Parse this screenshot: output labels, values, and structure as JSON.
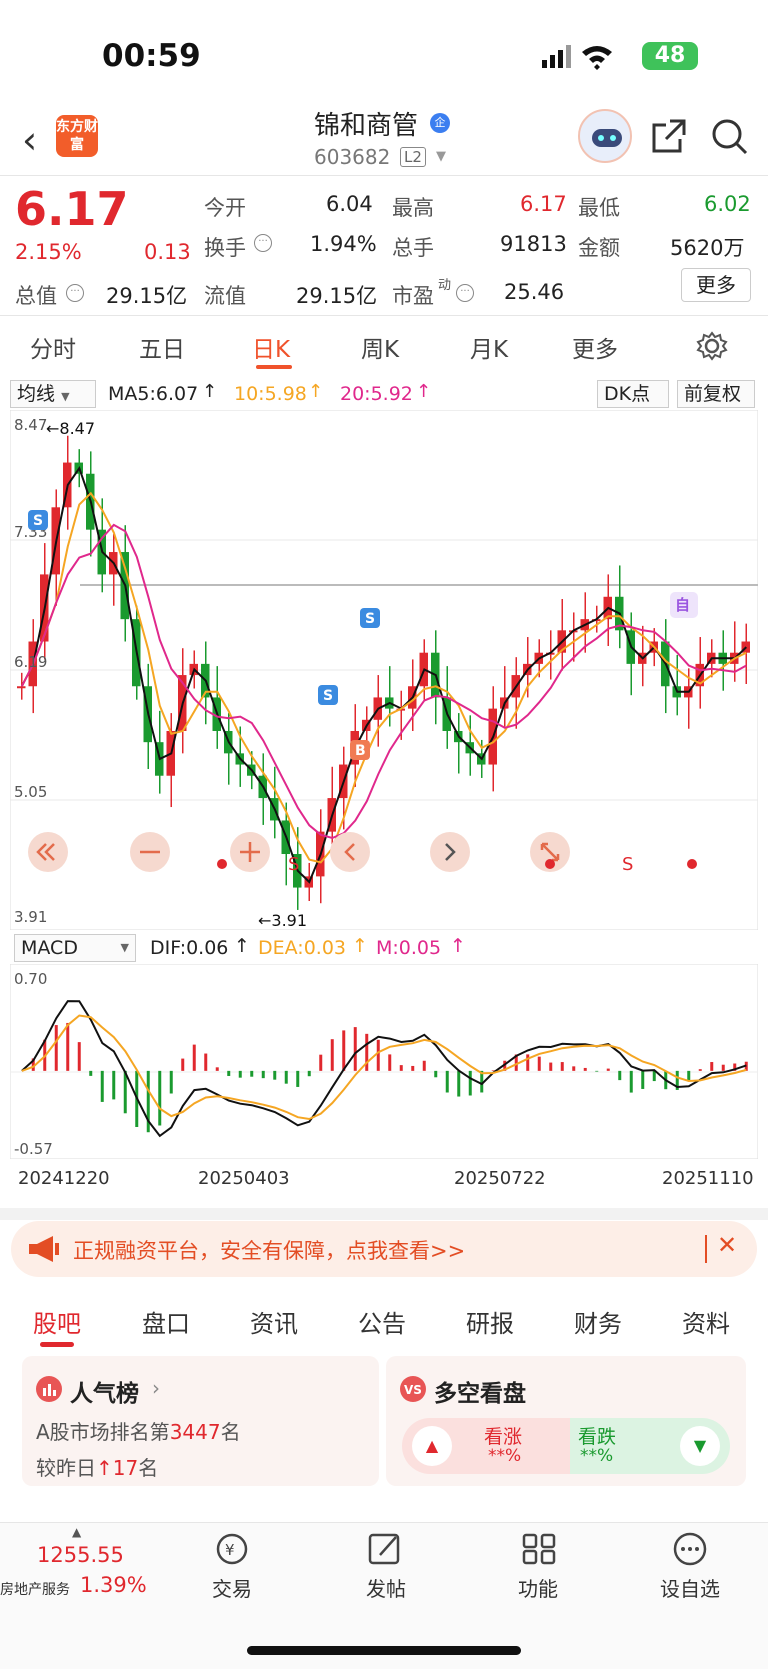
{
  "status_bar": {
    "time": "00:59",
    "battery": "48"
  },
  "header": {
    "logo_text": "东方财富",
    "stock_name": "锦和商管",
    "badge": "企",
    "stock_code": "603682",
    "level": "L2"
  },
  "quote": {
    "price": "6.17",
    "change_pct": "2.15%",
    "change": "0.13",
    "open_label": "今开",
    "open": "6.04",
    "high_label": "最高",
    "high": "6.17",
    "low_label": "最低",
    "low": "6.02",
    "turnover_label": "换手",
    "turnover": "1.94%",
    "volume_label": "总手",
    "volume": "91813",
    "amount_label": "金额",
    "amount": "5620万",
    "mktcap_label": "总值",
    "mktcap": "29.15亿",
    "float_label": "流值",
    "float": "29.15亿",
    "pe_label": "市盈",
    "pe_sup": "动",
    "pe": "25.46",
    "more_label": "更多"
  },
  "period_tabs": [
    "分时",
    "五日",
    "日K",
    "周K",
    "月K",
    "更多"
  ],
  "chart_toolbar": {
    "ma_select": "均线",
    "ma5": "MA5:6.07",
    "ma10": "10:5.98",
    "ma20": "20:5.92",
    "dk_select": "DK点",
    "adjust": "前复权"
  },
  "macd_toolbar": {
    "select": "MACD",
    "dif": "DIF:0.06",
    "dea": "DEA:0.03",
    "m": "M:0.05"
  },
  "colors": {
    "up": "#e0282e",
    "down": "#1a9a2f",
    "ma5": "#111111",
    "ma10": "#f5a623",
    "ma20": "#e0288c",
    "accent": "#f0522b"
  },
  "chart_data": {
    "type": "candlestick",
    "y_axis": {
      "max_label": "8.47",
      "mid1": "7.33",
      "mid2": "6.19",
      "mid3": "5.05",
      "min_label": "3.91",
      "ylim": [
        3.91,
        8.47
      ]
    },
    "annotations": {
      "high": "8.47",
      "low": "3.91"
    },
    "ma_close": [
      6.0,
      6.4,
      7.0,
      7.6,
      8.0,
      7.9,
      7.4,
      7.0,
      7.2,
      6.6,
      6.0,
      5.5,
      5.2,
      5.6,
      6.1,
      6.2,
      5.9,
      5.6,
      5.4,
      5.3,
      5.2,
      5.0,
      4.8,
      4.5,
      4.2,
      4.3,
      4.7,
      5.0,
      5.3,
      5.6,
      5.7,
      5.9,
      5.8,
      5.8,
      6.0,
      6.3,
      5.9,
      5.6,
      5.5,
      5.4,
      5.3,
      5.8,
      5.9,
      6.1,
      6.2,
      6.3,
      6.3,
      6.5,
      6.5,
      6.6,
      6.6,
      6.8,
      6.5,
      6.2,
      6.3,
      6.4,
      6.0,
      5.9,
      6.0,
      6.2,
      6.3,
      6.2,
      6.3,
      6.4
    ],
    "macd": {
      "ylim": [
        -0.57,
        0.7
      ],
      "max_label": "0.70",
      "min_label": "-0.57"
    },
    "x_labels": [
      "20241220",
      "20250403",
      "20250722",
      "20251110"
    ]
  },
  "ad": {
    "text": "正规融资平台，安全有保障，点我查看>>"
  },
  "content_tabs": [
    "股吧",
    "盘口",
    "资讯",
    "公告",
    "研报",
    "财务",
    "资料"
  ],
  "popularity": {
    "title": "人气榜",
    "rank_prefix": "A股市场排名第",
    "rank": "3447",
    "rank_suffix": "名",
    "change_prefix": "较昨日",
    "change": "17",
    "change_suffix": "名"
  },
  "vote": {
    "title": "多空看盘",
    "bull": "看涨",
    "bull_pct": "**%",
    "bear": "看跌",
    "bear_pct": "**%"
  },
  "bottom_nav": {
    "index_value": "1255.55",
    "index_name": "房地产服务",
    "index_change": "1.39%",
    "items": [
      "交易",
      "发帖",
      "功能",
      "设自选"
    ]
  }
}
